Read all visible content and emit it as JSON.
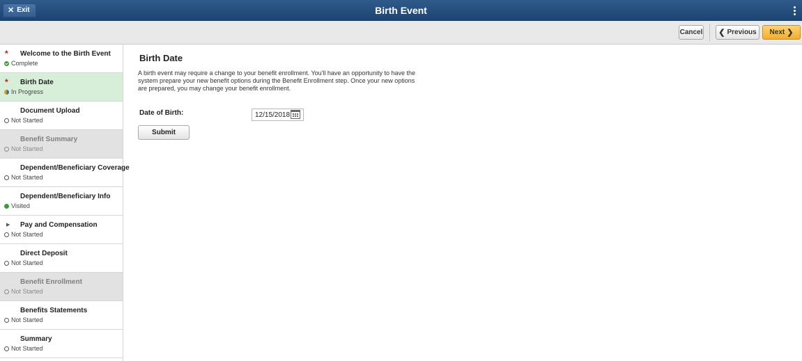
{
  "banner": {
    "exit_label": "Exit",
    "title": "Birth Event"
  },
  "toolbar": {
    "cancel_label": "Cancel",
    "previous_label": "Previous",
    "next_label": "Next"
  },
  "sidebar": {
    "steps": [
      {
        "title": "Welcome to the Birth Event",
        "status": "Complete",
        "required": true,
        "state": "complete"
      },
      {
        "title": "Birth Date",
        "status": "In Progress",
        "required": true,
        "state": "in-progress",
        "active": true
      },
      {
        "title": "Document Upload",
        "status": "Not Started",
        "state": "not-started"
      },
      {
        "title": "Benefit Summary",
        "status": "Not Started",
        "state": "not-started",
        "disabled": true
      },
      {
        "title": "Dependent/Beneficiary Coverage",
        "status": "Not Started",
        "state": "not-started"
      },
      {
        "title": "Dependent/Beneficiary Info",
        "status": "Visited",
        "state": "visited"
      },
      {
        "title": "Pay and Compensation",
        "status": "Not Started",
        "state": "not-started",
        "expandable": true
      },
      {
        "title": "Direct Deposit",
        "status": "Not Started",
        "state": "not-started"
      },
      {
        "title": "Benefit Enrollment",
        "status": "Not Started",
        "state": "not-started",
        "disabled": true
      },
      {
        "title": "Benefits Statements",
        "status": "Not Started",
        "state": "not-started"
      },
      {
        "title": "Summary",
        "status": "Not Started",
        "state": "not-started"
      }
    ]
  },
  "main": {
    "title": "Birth Date",
    "description": "A birth event may require a change to your benefit enrollment. You'll have an opportunity to have the system prepare your new benefit options during the Benefit Enrollment step. Once your new options are prepared, you may change your benefit enrollment.",
    "dob_label": "Date of Birth:",
    "dob_value": "12/15/2018",
    "submit_label": "Submit"
  },
  "colors": {
    "banner": "#1d4574",
    "next_button": "#f2ad33",
    "active_step": "#d7efd9",
    "disabled_step": "#e2e2e2",
    "required_star": "#c41818"
  }
}
